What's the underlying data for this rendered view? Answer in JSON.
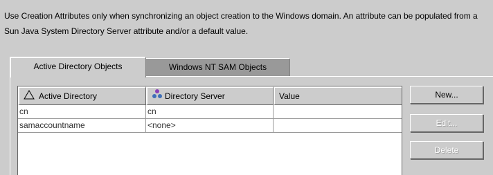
{
  "description": "Use Creation Attributes only when synchronizing an object creation to the Windows domain.  An attribute can be populated from a Sun Java System Directory Server attribute and/or a default value.",
  "tabs": [
    {
      "label": "Active Directory Objects",
      "active": true
    },
    {
      "label": "Windows NT SAM Objects",
      "active": false
    }
  ],
  "table": {
    "columns": [
      "Active Directory",
      "Directory Server",
      "Value"
    ],
    "sort_column": "Active Directory",
    "rows": [
      [
        "cn",
        "cn",
        ""
      ],
      [
        "samaccountname",
        "<none>",
        ""
      ]
    ]
  },
  "buttons": {
    "new": "New...",
    "edit": "Edit...",
    "delete": "Delete"
  },
  "icons": {
    "sort": "sort-ascending-triangle-icon",
    "directory_server": "directory-server-group-icon"
  },
  "colors": {
    "background": "#cccccc",
    "inactive_tab": "#999999",
    "table_bg": "#ffffff"
  }
}
